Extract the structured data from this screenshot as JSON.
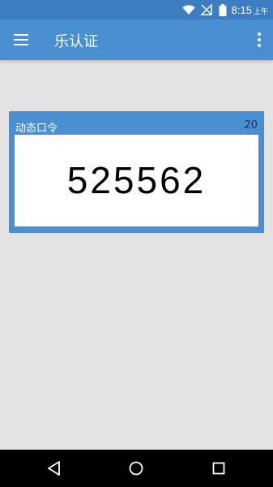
{
  "status_bar": {
    "time": "8:15",
    "ampm": "上午",
    "icons": [
      "wifi-icon",
      "signal-icon",
      "battery-icon"
    ]
  },
  "app_bar": {
    "title": "乐认证",
    "icons": [
      "menu-icon",
      "more-vert-icon"
    ]
  },
  "otp_card": {
    "label": "动态口令",
    "countdown": "20",
    "code": "525562"
  },
  "nav_bar": {
    "icons": [
      "back-icon",
      "home-icon",
      "recents-icon"
    ]
  },
  "colors": {
    "status_bar": "#3d7ec2",
    "app_bar": "#4a8fd2",
    "card": "#4a8fd2",
    "background": "#e3e3e3",
    "nav_bar": "#000000"
  }
}
